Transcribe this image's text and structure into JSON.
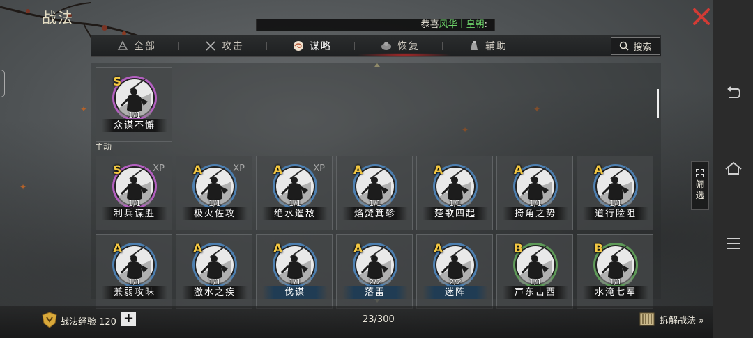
{
  "window": {
    "title": "战法",
    "banner": {
      "prefix": "恭喜",
      "highlight": "风华丨皇朝",
      "suffix": ":"
    }
  },
  "tabs": [
    {
      "label": "全部",
      "icon": "all-icon",
      "active": false
    },
    {
      "label": "攻击",
      "icon": "crossed-swords-icon",
      "active": false
    },
    {
      "label": "谋略",
      "icon": "strategy-swirl-icon",
      "active": true
    },
    {
      "label": "恢复",
      "icon": "recover-icon",
      "active": false
    },
    {
      "label": "辅助",
      "icon": "assist-icon",
      "active": false
    }
  ],
  "search": {
    "label": "搜索"
  },
  "section": {
    "active_label": "主动"
  },
  "featured": [
    {
      "name": "众谋不懈",
      "grade": "S",
      "count": "1/1",
      "xp": "",
      "ring": "#b35fc0",
      "style": "dark"
    }
  ],
  "cards_row1": [
    {
      "name": "利兵谋胜",
      "grade": "S",
      "count": "1/1",
      "xp": "XP",
      "ring": "#b35fc0",
      "style": "dark"
    },
    {
      "name": "极火佐攻",
      "grade": "A",
      "count": "1/1",
      "xp": "XP",
      "ring": "#4d7fb0",
      "style": "dark"
    },
    {
      "name": "绝水遏敌",
      "grade": "A",
      "count": "1/1",
      "xp": "XP",
      "ring": "#4d7fb0",
      "style": "dark"
    },
    {
      "name": "焰焚箕轸",
      "grade": "A",
      "count": "1/1",
      "xp": "",
      "ring": "#4d7fb0",
      "style": "dark"
    },
    {
      "name": "楚歌四起",
      "grade": "A",
      "count": "1/1",
      "xp": "",
      "ring": "#4d7fb0",
      "style": "dark"
    },
    {
      "name": "掎角之势",
      "grade": "A",
      "count": "1/1",
      "xp": "",
      "ring": "#4d7fb0",
      "style": "dark"
    },
    {
      "name": "道行险阻",
      "grade": "A",
      "count": "1/1",
      "xp": "",
      "ring": "#4d7fb0",
      "style": "dark"
    }
  ],
  "cards_row2": [
    {
      "name": "兼弱攻昧",
      "grade": "A",
      "count": "1/1",
      "xp": "",
      "ring": "#4d7fb0",
      "style": "dark"
    },
    {
      "name": "激水之疾",
      "grade": "A",
      "count": "1/1",
      "xp": "",
      "ring": "#4d7fb0",
      "style": "dark"
    },
    {
      "name": "伐谋",
      "grade": "A",
      "count": "1/1",
      "xp": "",
      "ring": "#4d7fb0",
      "style": "plain"
    },
    {
      "name": "落雷",
      "grade": "A",
      "count": "2/2",
      "xp": "",
      "ring": "#4d7fb0",
      "style": "plain"
    },
    {
      "name": "迷阵",
      "grade": "A",
      "count": "2/2",
      "xp": "",
      "ring": "#4d7fb0",
      "style": "plain"
    },
    {
      "name": "声东击西",
      "grade": "B",
      "count": "1/1",
      "xp": "",
      "ring": "#5e9a58",
      "style": "dark"
    },
    {
      "name": "水淹七军",
      "grade": "B",
      "count": "1/1",
      "xp": "",
      "ring": "#5e9a58",
      "style": "dark"
    }
  ],
  "bottom": {
    "exp_label": "战法经验 120",
    "plus": "+",
    "total": "23/300",
    "dismantle": "拆解战法 »"
  },
  "filter": {
    "line1": "筛",
    "line2": "选"
  },
  "colors": {
    "grade": "#f2c742",
    "close": "#d23b35",
    "banner_highlight": "#6ed46a"
  }
}
